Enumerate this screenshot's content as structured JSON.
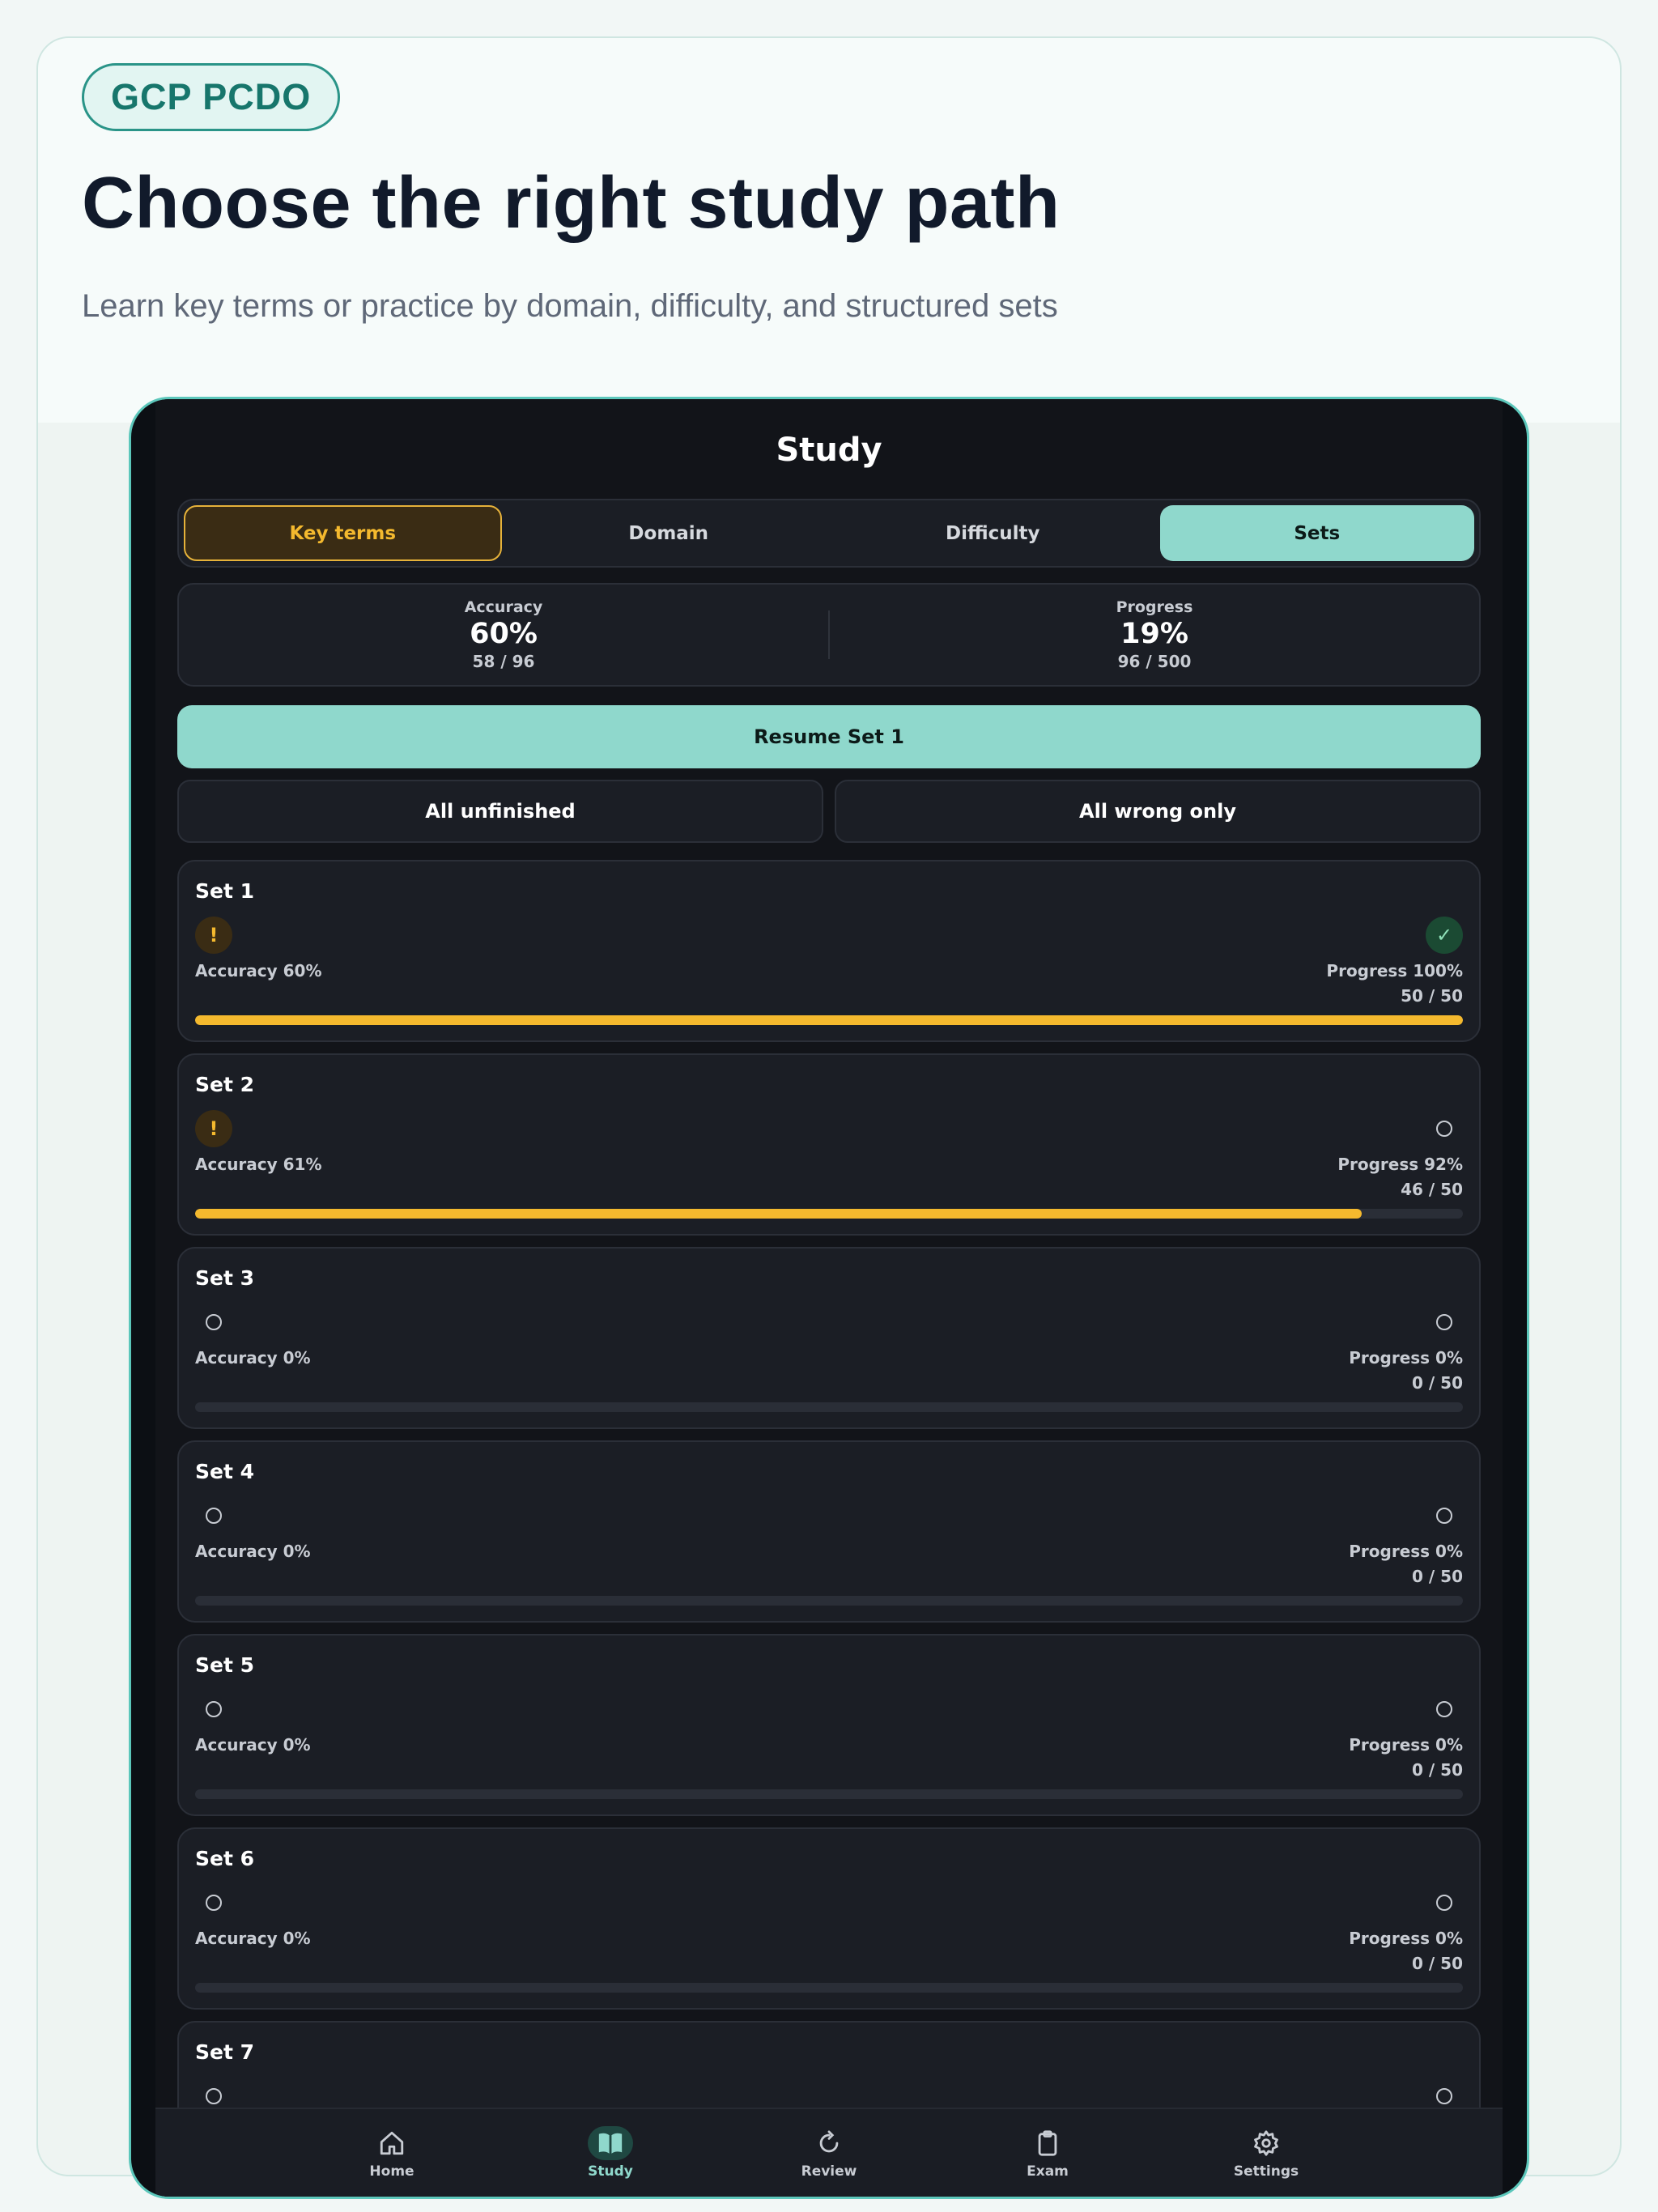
{
  "hero": {
    "badge": "GCP PCDO",
    "headline": "Choose the right study path",
    "subline": "Learn key terms or practice by domain, difficulty, and structured sets"
  },
  "screen": {
    "title": "Study",
    "tabs": [
      {
        "label": "Key terms",
        "state": "highlighted"
      },
      {
        "label": "Domain",
        "state": "normal"
      },
      {
        "label": "Difficulty",
        "state": "normal"
      },
      {
        "label": "Sets",
        "state": "active"
      }
    ],
    "stats": {
      "accuracy": {
        "label": "Accuracy",
        "value": "60%",
        "sub": "58 / 96"
      },
      "progress": {
        "label": "Progress",
        "value": "19%",
        "sub": "96 / 500"
      }
    },
    "resume_label": "Resume Set 1",
    "filters": [
      "All unfinished",
      "All wrong only"
    ],
    "sets": [
      {
        "name": "Set 1",
        "accuracy": "Accuracy 60%",
        "progress": "Progress 100%",
        "count": "50 / 50",
        "left_icon": "warning-icon",
        "right_icon": "check-icon",
        "fill": 1.0
      },
      {
        "name": "Set 2",
        "accuracy": "Accuracy 61%",
        "progress": "Progress 92%",
        "count": "46 / 50",
        "left_icon": "warning-icon",
        "right_icon": "circle-icon",
        "fill": 0.92
      },
      {
        "name": "Set 3",
        "accuracy": "Accuracy 0%",
        "progress": "Progress 0%",
        "count": "0 / 50",
        "left_icon": "circle-icon",
        "right_icon": "circle-icon",
        "fill": 0
      },
      {
        "name": "Set 4",
        "accuracy": "Accuracy 0%",
        "progress": "Progress 0%",
        "count": "0 / 50",
        "left_icon": "circle-icon",
        "right_icon": "circle-icon",
        "fill": 0
      },
      {
        "name": "Set 5",
        "accuracy": "Accuracy 0%",
        "progress": "Progress 0%",
        "count": "0 / 50",
        "left_icon": "circle-icon",
        "right_icon": "circle-icon",
        "fill": 0
      },
      {
        "name": "Set 6",
        "accuracy": "Accuracy 0%",
        "progress": "Progress 0%",
        "count": "0 / 50",
        "left_icon": "circle-icon",
        "right_icon": "circle-icon",
        "fill": 0
      },
      {
        "name": "Set 7",
        "accuracy": "",
        "progress": "",
        "count": "",
        "left_icon": "circle-icon",
        "right_icon": "circle-icon",
        "fill": 0
      }
    ],
    "nav": [
      {
        "label": "Home",
        "icon": "home-icon"
      },
      {
        "label": "Study",
        "icon": "book-icon",
        "active": true
      },
      {
        "label": "Review",
        "icon": "refresh-icon"
      },
      {
        "label": "Exam",
        "icon": "clipboard-icon"
      },
      {
        "label": "Settings",
        "icon": "gear-icon"
      }
    ]
  },
  "colors": {
    "accent_teal": "#8fd8cc",
    "warning_yellow": "#f4b92e",
    "badge_teal": "#17766c",
    "heading": "#111a2b"
  }
}
